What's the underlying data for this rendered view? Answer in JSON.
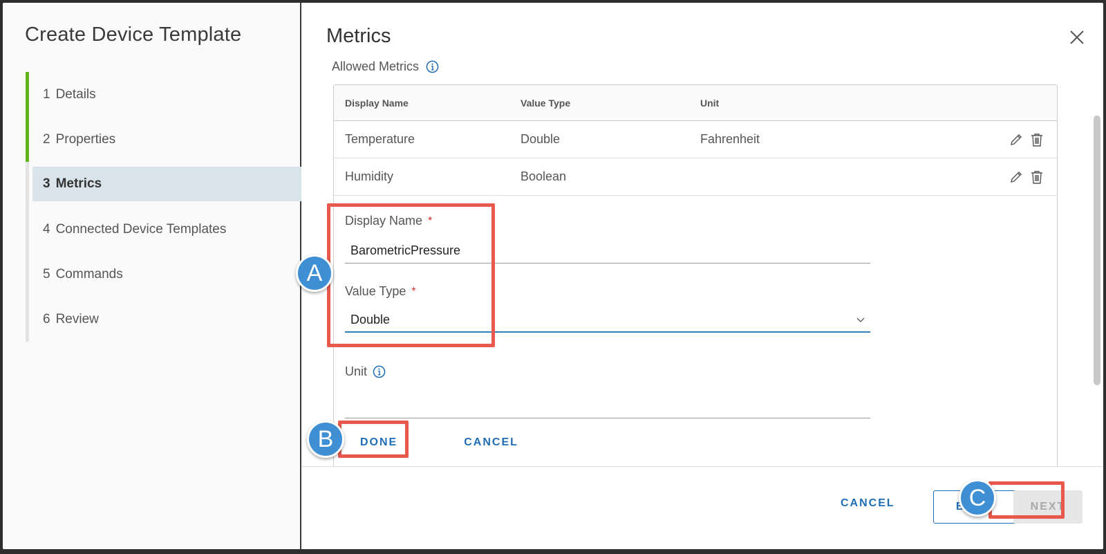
{
  "wizard": {
    "title": "Create Device Template",
    "steps": [
      {
        "num": "1",
        "label": "Details"
      },
      {
        "num": "2",
        "label": "Properties"
      },
      {
        "num": "3",
        "label": "Metrics"
      },
      {
        "num": "4",
        "label": "Connected Device Templates"
      },
      {
        "num": "5",
        "label": "Commands"
      },
      {
        "num": "6",
        "label": "Review"
      }
    ]
  },
  "page": {
    "title": "Metrics",
    "section_label": "Allowed Metrics"
  },
  "grid": {
    "headers": [
      "Display Name",
      "Value Type",
      "Unit"
    ],
    "rows": [
      {
        "name": "Temperature",
        "type": "Double",
        "unit": "Fahrenheit"
      },
      {
        "name": "Humidity",
        "type": "Boolean",
        "unit": ""
      }
    ]
  },
  "form": {
    "display_name_label": "Display Name",
    "display_name_value": "BarometricPressure",
    "value_type_label": "Value Type",
    "value_type_value": "Double",
    "unit_label": "Unit",
    "unit_value": "",
    "required_mark": "*",
    "done_label": "DONE",
    "cancel_label": "CANCEL"
  },
  "footer": {
    "cancel_label": "CANCEL",
    "back_label": "BACK",
    "next_label": "NEXT"
  },
  "callouts": {
    "a": "A",
    "b": "B",
    "c": "C"
  },
  "colors": {
    "accent": "#1f6db5",
    "progress": "#62b418",
    "callout": "#3e8fd3",
    "highlight": "#e8584c"
  }
}
